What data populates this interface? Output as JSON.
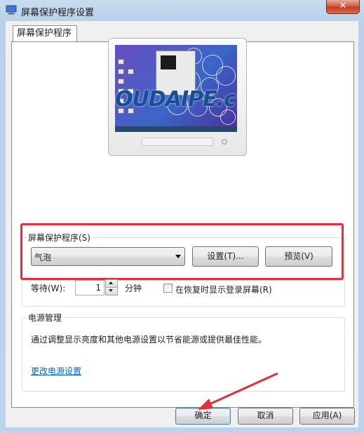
{
  "window": {
    "title": "屏幕保护程序设置",
    "close_label": "✕",
    "icon": "monitor-icon"
  },
  "tab": {
    "label": "屏幕保护程序"
  },
  "preview": {
    "watermark": "OUDAIPE.c"
  },
  "screensaver": {
    "group_label": "屏幕保护程序(S)",
    "selected": "气泡",
    "settings_button": "设置(T)...",
    "preview_button": "预览(V)",
    "wait_label": "等待(W):",
    "wait_value": "1",
    "wait_unit": "分钟",
    "resume_checkbox_label": "在恢复时显示登录屏幕(R)",
    "resume_checked": false
  },
  "power": {
    "group_label": "电源管理",
    "description": "通过调整显示亮度和其他电源设置以节省能源或提供最佳性能。",
    "link": "更改电源设置"
  },
  "footer": {
    "ok": "确定",
    "cancel": "取消",
    "apply": "应用(A)"
  },
  "colors": {
    "highlight_box": "#e0303c",
    "link": "#0066cc"
  }
}
